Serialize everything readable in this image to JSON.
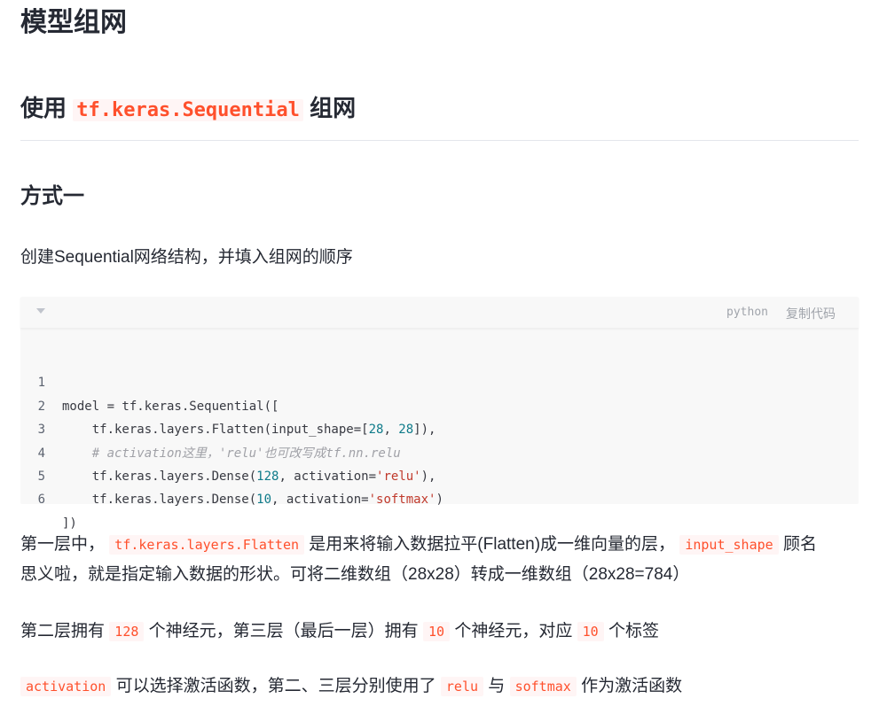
{
  "h1": "模型组网",
  "h2": {
    "pre": "使用 ",
    "code": "tf.keras.Sequential",
    "post": " 组网"
  },
  "h3": "方式一",
  "intro": "创建Sequential网络结构，并填入组网的顺序",
  "codeblock": {
    "language": "python",
    "copy_label": "复制代码",
    "collapse_icon": "caret-down-icon",
    "lines": [
      {
        "n": "1",
        "a": "model = tf.keras.Sequential(["
      },
      {
        "n": "2",
        "a": "    tf.keras.layers.Flatten(input_shape=[",
        "num1": "28",
        "b": ", ",
        "num2": "28",
        "c": "]),"
      },
      {
        "n": "3",
        "comment": "    # activation这里，'relu'也可改写成tf.nn.relu"
      },
      {
        "n": "4",
        "a": "    tf.keras.layers.Dense(",
        "num1": "128",
        "b": ", activation=",
        "str": "'relu'",
        "c": "),"
      },
      {
        "n": "5",
        "a": "    tf.keras.layers.Dense(",
        "num1": "10",
        "b": ", activation=",
        "str": "'softmax'",
        "c": ")"
      },
      {
        "n": "6",
        "a": "])"
      }
    ]
  },
  "para1": {
    "t1": "第一层中，",
    "c1": "tf.keras.layers.Flatten",
    "t2": "是用来将输入数据拉平(Flatten)成一维向量的层，",
    "c2": "input_shape",
    "t3": "顾名",
    "line2": "思义啦，就是指定输入数据的形状。可将二维数组（28x28）转成一维数组（28x28=784）"
  },
  "para2": {
    "t1": "第二层拥有",
    "c1": "128",
    "t2": "个神经元，第三层（最后一层）拥有",
    "c2": "10",
    "t3": "个神经元，对应",
    "c3": "10",
    "t4": "个标签"
  },
  "para3": {
    "c1": "activation",
    "t1": "可以选择激活函数，第二、三层分别使用了",
    "c2": "relu",
    "t2": "与",
    "c3": "softmax",
    "t3": "作为激活函数"
  }
}
